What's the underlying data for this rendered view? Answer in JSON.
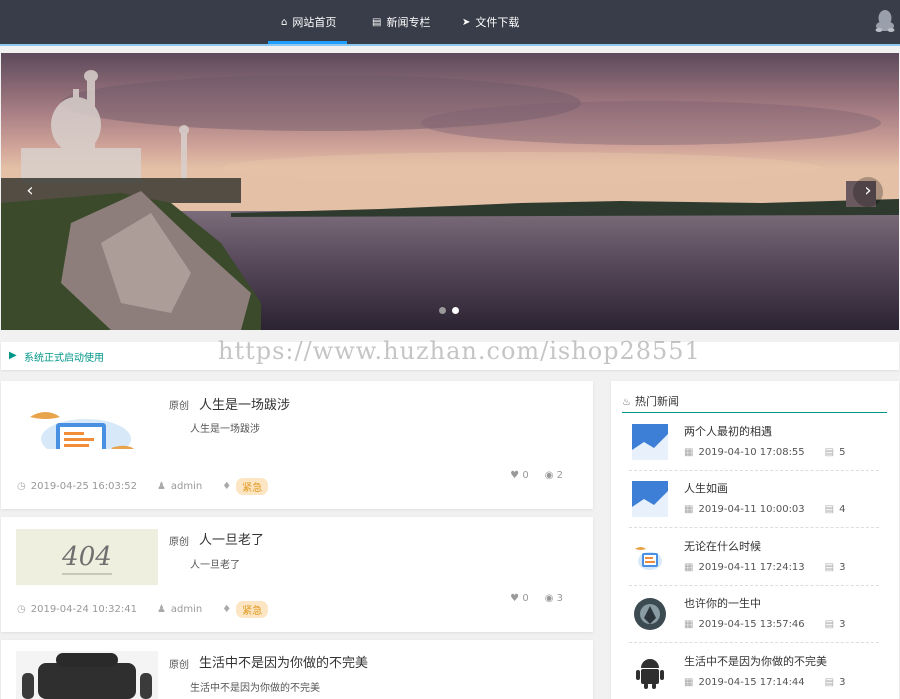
{
  "nav": {
    "items": [
      {
        "label": "网站首页",
        "icon": "home-icon",
        "active": true
      },
      {
        "label": "新闻专栏",
        "icon": "file-icon",
        "active": false
      },
      {
        "label": "文件下载",
        "icon": "send-icon",
        "active": false
      }
    ],
    "login_icon": "qq-icon"
  },
  "carousel": {
    "prev": "‹",
    "next": "›",
    "slides": 2,
    "active_slide": 2
  },
  "notice": {
    "text": "系统正式启动使用"
  },
  "watermark": "https://www.huzhan.com/ishop28551",
  "articles": [
    {
      "badge_orig": "原创",
      "title": "人生是一场跋涉",
      "summary": "人生是一场跋涉",
      "date": "2019-04-25 16:03:52",
      "author": "admin",
      "tag": "紧急",
      "comments": "0",
      "views": "2",
      "thumb": "illustration"
    },
    {
      "badge_orig": "原创",
      "title": "人一旦老了",
      "summary": "人一旦老了",
      "date": "2019-04-24 10:32:41",
      "author": "admin",
      "tag": "紧急",
      "comments": "0",
      "views": "3",
      "thumb": "404"
    },
    {
      "badge_orig": "原创",
      "title": "生活中不是因为你做的不完美",
      "summary": "生活中不是因为你做的不完美",
      "thumb": "android"
    }
  ],
  "thumb_404": {
    "code": "404"
  },
  "hot": {
    "title": "热门新闻",
    "items": [
      {
        "title": "两个人最初的相遇",
        "date": "2019-04-10 17:08:55",
        "views": "5",
        "thumb": "blue"
      },
      {
        "title": "人生如画",
        "date": "2019-04-11 10:00:03",
        "views": "4",
        "thumb": "blue"
      },
      {
        "title": "无论在什么时候",
        "date": "2019-04-11 17:24:13",
        "views": "3",
        "thumb": "illustration"
      },
      {
        "title": "也许你的一生中",
        "date": "2019-04-15 13:57:46",
        "views": "3",
        "thumb": "shield"
      },
      {
        "title": "生活中不是因为你做的不完美",
        "date": "2019-04-15 17:14:44",
        "views": "3",
        "thumb": "android"
      }
    ]
  },
  "colors": {
    "nav_bg": "#393d49",
    "accent": "#1e9fff",
    "teal": "#009688",
    "badge": "#fbe5c2"
  }
}
